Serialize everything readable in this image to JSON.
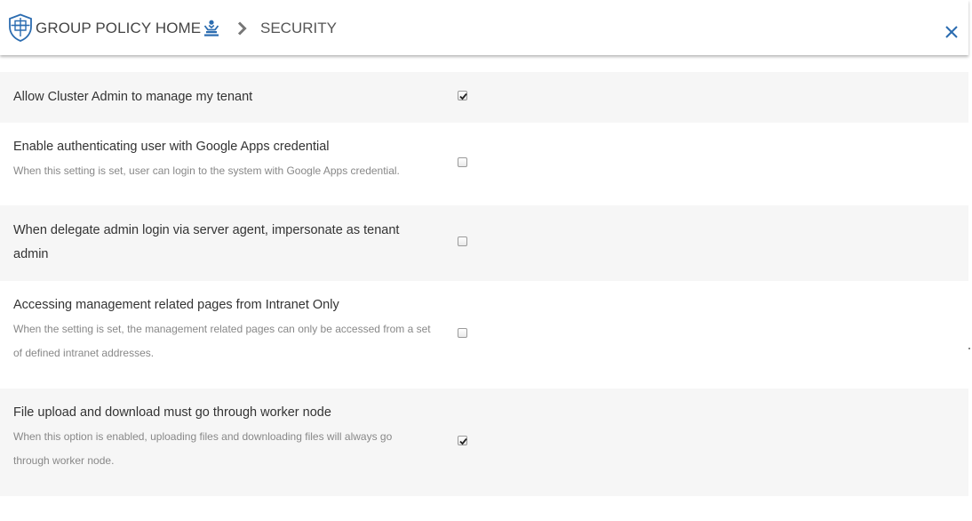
{
  "header": {
    "title": "GROUP POLICY HOME",
    "home_icon": "user-home-icon",
    "separator_icon": "chevron-right-icon",
    "current": "SECURITY",
    "close_icon": "close-icon",
    "accent_color": "#2b6cb0"
  },
  "settings": [
    {
      "label": "Allow Cluster Admin to manage my tenant",
      "description": "",
      "checked": true
    },
    {
      "label": "Enable authenticating user with Google Apps credential",
      "description": "When this setting is set, user can login to the system with Google Apps credential.",
      "checked": false
    },
    {
      "label": "When delegate admin login via server agent, impersonate as tenant admin",
      "description": "",
      "checked": false
    },
    {
      "label": "Accessing management related pages from Intranet Only",
      "description": "When the setting is set, the management related pages can only be accessed from a set of defined intranet addresses.",
      "checked": false
    },
    {
      "label": "File upload and download must go through worker node",
      "description": "When this option is enabled, uploading files and downloading files will always go through worker node.",
      "checked": true
    }
  ]
}
